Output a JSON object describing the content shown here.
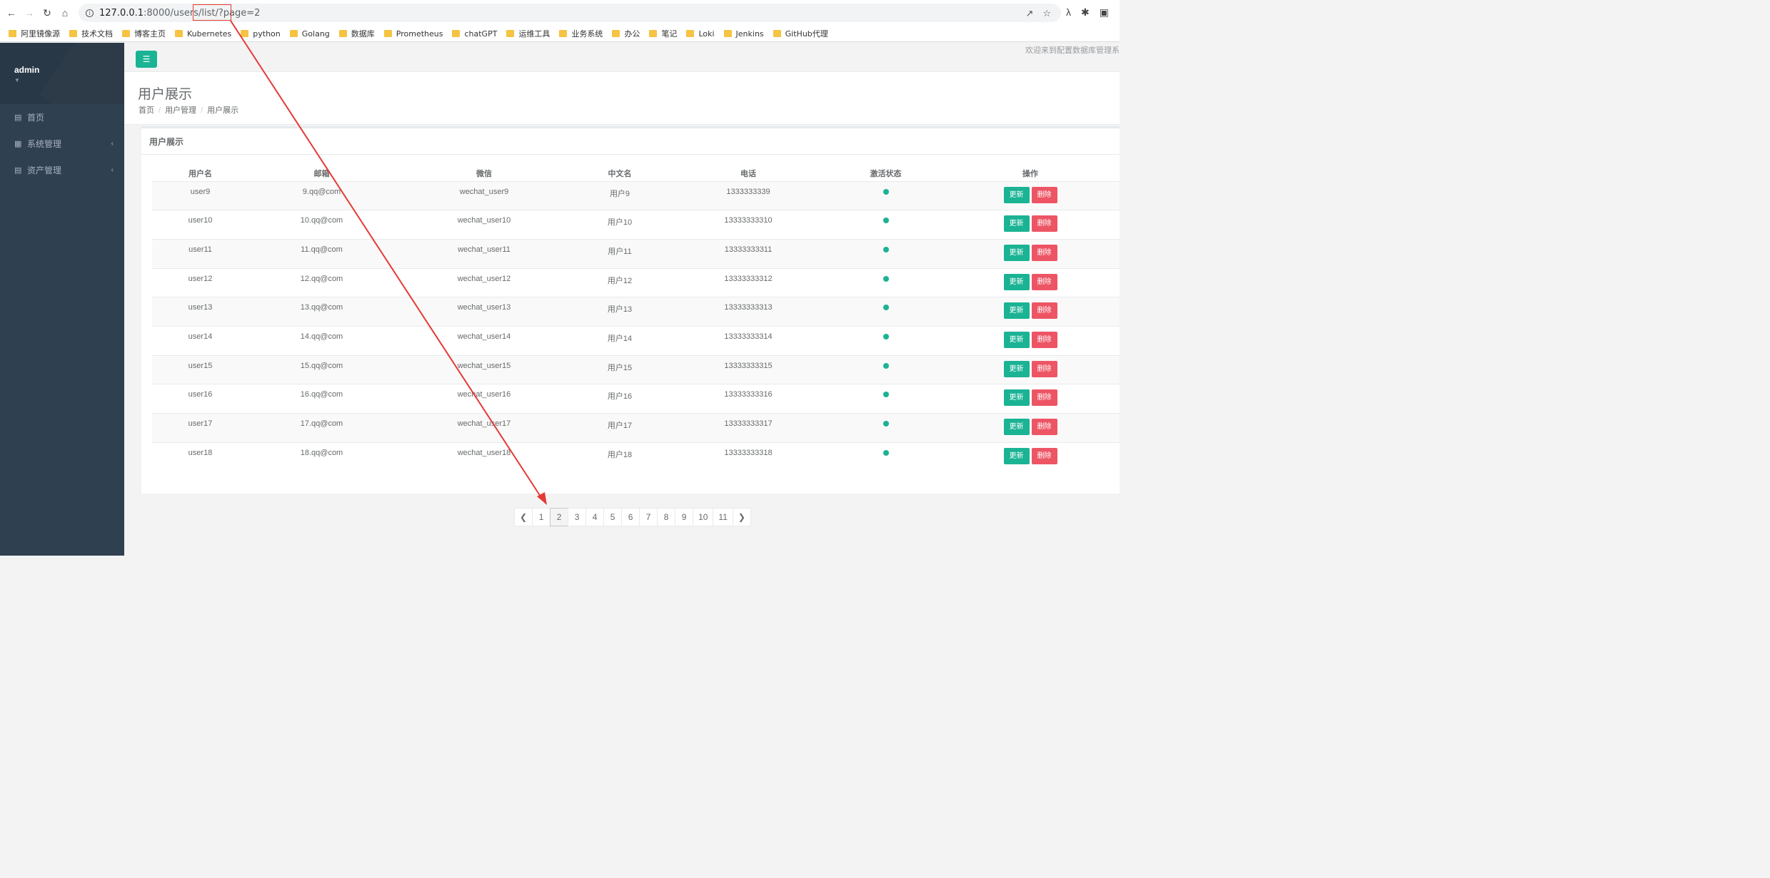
{
  "browser": {
    "url_host": "127.0.0.1",
    "url_path": ":8000/users/list/?page=2",
    "bookmarks": [
      "阿里镜像源",
      "技术文档",
      "博客主页",
      "Kubernetes",
      "python",
      "Golang",
      "数据库",
      "Prometheus",
      "chatGPT",
      "运维工具",
      "业务系统",
      "办公",
      "笔记",
      "Loki",
      "Jenkins",
      "GitHub代理"
    ]
  },
  "sidebar": {
    "user": "admin",
    "items": [
      {
        "label": "首页",
        "icon": "bar-chart-icon"
      },
      {
        "label": "系统管理",
        "icon": "grid-icon"
      },
      {
        "label": "资产管理",
        "icon": "bar-chart-icon"
      }
    ]
  },
  "topbar": {
    "welcome": "欢迎来到配置数据库管理系"
  },
  "heading": {
    "title": "用户展示",
    "breadcrumb": [
      "首页",
      "用户管理",
      "用户展示"
    ]
  },
  "panel": {
    "title": "用户展示",
    "columns": [
      "用户名",
      "邮箱",
      "微信",
      "中文名",
      "电话",
      "激活状态",
      "操作"
    ],
    "update_label": "更新",
    "delete_label": "删除",
    "rows": [
      [
        "user9",
        "9.qq@com",
        "wechat_user9",
        "用户9",
        "1333333339"
      ],
      [
        "user10",
        "10.qq@com",
        "wechat_user10",
        "用户10",
        "13333333310"
      ],
      [
        "user11",
        "11.qq@com",
        "wechat_user11",
        "用户11",
        "13333333311"
      ],
      [
        "user12",
        "12.qq@com",
        "wechat_user12",
        "用户12",
        "13333333312"
      ],
      [
        "user13",
        "13.qq@com",
        "wechat_user13",
        "用户13",
        "13333333313"
      ],
      [
        "user14",
        "14.qq@com",
        "wechat_user14",
        "用户14",
        "13333333314"
      ],
      [
        "user15",
        "15.qq@com",
        "wechat_user15",
        "用户15",
        "13333333315"
      ],
      [
        "user16",
        "16.qq@com",
        "wechat_user16",
        "用户16",
        "13333333316"
      ],
      [
        "user17",
        "17.qq@com",
        "wechat_user17",
        "用户17",
        "13333333317"
      ],
      [
        "user18",
        "18.qq@com",
        "wechat_user18",
        "用户18",
        "13333333318"
      ]
    ],
    "status_color": "#1ab394"
  },
  "pagination": {
    "pages": [
      "1",
      "2",
      "3",
      "4",
      "5",
      "6",
      "7",
      "8",
      "9",
      "10",
      "11"
    ],
    "current": "2"
  },
  "colors": {
    "sidebar": "#2f4050",
    "primary": "#1ab394",
    "danger": "#ed5565",
    "annotation": "#e53935"
  }
}
